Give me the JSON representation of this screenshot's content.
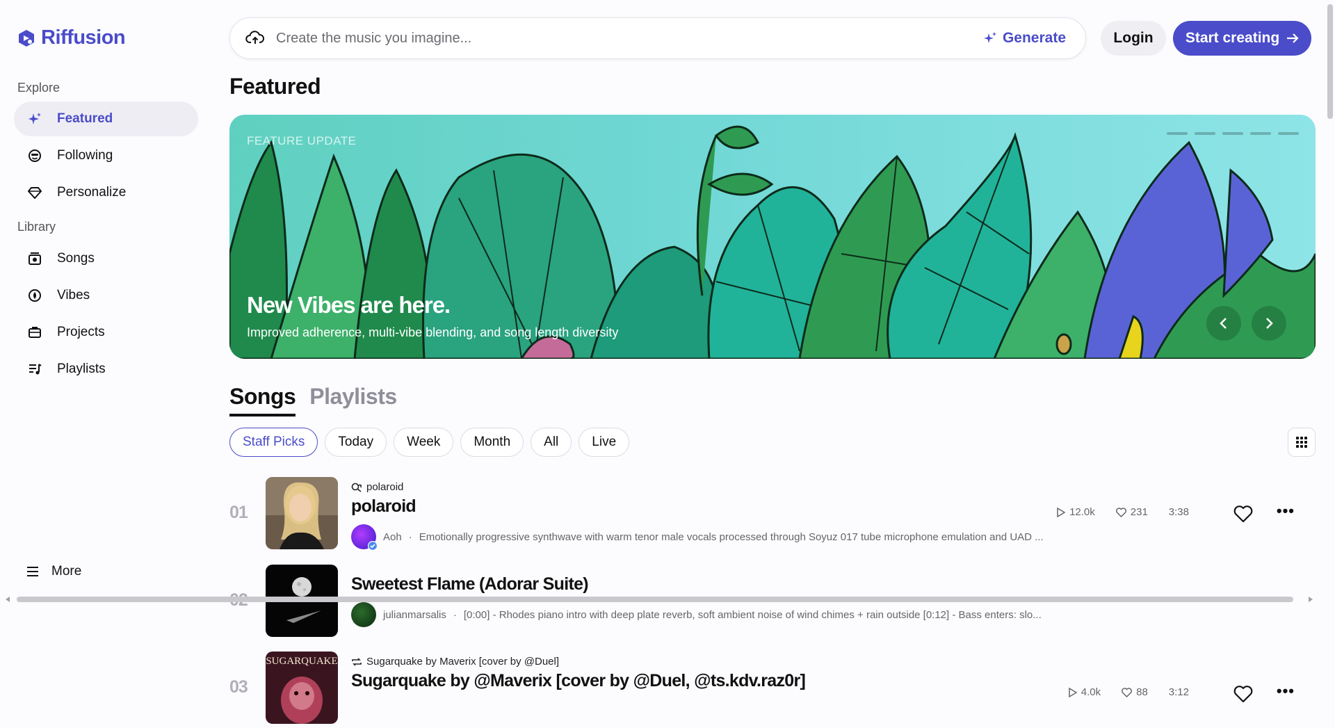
{
  "brand": {
    "name": "Riffusion",
    "color": "#4a4cc9"
  },
  "sidebar": {
    "explore_label": "Explore",
    "explore_items": [
      {
        "label": "Featured",
        "icon": "sparkle-icon",
        "active": true
      },
      {
        "label": "Following",
        "icon": "smiley-icon"
      },
      {
        "label": "Personalize",
        "icon": "gem-icon"
      }
    ],
    "library_label": "Library",
    "library_items": [
      {
        "label": "Songs",
        "icon": "disc-stack-icon"
      },
      {
        "label": "Vibes",
        "icon": "vibe-icon"
      },
      {
        "label": "Projects",
        "icon": "folder-icon"
      },
      {
        "label": "Playlists",
        "icon": "playlist-icon"
      }
    ],
    "more_label": "More"
  },
  "search": {
    "placeholder": "Create the music you imagine...",
    "generate_label": "Generate"
  },
  "header": {
    "login_label": "Login",
    "start_label": "Start creating"
  },
  "page_title": "Featured",
  "hero": {
    "tag": "FEATURE UPDATE",
    "title": "New Vibes are here.",
    "subtitle": "Improved adherence, multi-vibe blending, and song length diversity",
    "slides": 5
  },
  "tabs": [
    "Songs",
    "Playlists"
  ],
  "filters": [
    "Staff Picks",
    "Today",
    "Week",
    "Month",
    "All",
    "Live"
  ],
  "songs": [
    {
      "rank": "01",
      "source": "polaroid",
      "title": "polaroid",
      "artist": "Aoh",
      "description": "Emotionally progressive synthwave with warm tenor male vocals processed through Soyuz 017 tube microphone emulation and UAD ...",
      "plays": "12.0k",
      "likes": "231",
      "duration": "3:38"
    },
    {
      "rank": "02",
      "title": "Sweetest Flame (Adorar Suite)",
      "artist": "julianmarsalis",
      "description": "[0:00] - Rhodes piano intro with deep plate reverb, soft ambient noise of wind chimes + rain outside [0:12] - Bass enters: slo..."
    },
    {
      "rank": "03",
      "source": "Sugarquake by Maverix [cover by @Duel]",
      "title": "Sugarquake by @Maverix [cover by @Duel, @ts.kdv.raz0r]",
      "cover_text": "SUGARQUAKE",
      "plays": "4.0k",
      "likes": "88",
      "duration": "3:12"
    }
  ]
}
